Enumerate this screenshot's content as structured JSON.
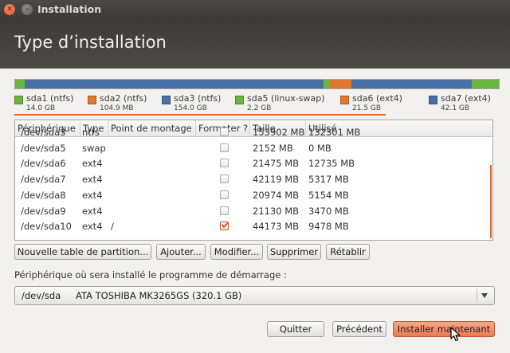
{
  "window": {
    "title": "Installation"
  },
  "header": {
    "title": "Type d’installation"
  },
  "partition_bar": [
    {
      "color": "#6ab43f",
      "pct": 1.9
    },
    {
      "color": "#4a6fa5",
      "pct": 61.9
    },
    {
      "color": "#6ab43f",
      "pct": 1.2
    },
    {
      "color": "#e0772b",
      "pct": 4.6
    },
    {
      "color": "#4a6fa5",
      "pct": 24.8
    },
    {
      "color": "#6ab43f",
      "pct": 5.6
    }
  ],
  "legend": [
    {
      "name": "sda1 (ntfs)",
      "size": "14.0 GB",
      "color": "#6ab43f"
    },
    {
      "name": "sda2 (ntfs)",
      "size": "104.9 MB",
      "color": "#e0772b"
    },
    {
      "name": "sda3 (ntfs)",
      "size": "154.0 GB",
      "color": "#4a6fa5"
    },
    {
      "name": "sda5 (linux-swap)",
      "size": "2.2 GB",
      "color": "#6ab43f"
    },
    {
      "name": "sda6 (ext4)",
      "size": "21.5 GB",
      "color": "#e0772b"
    },
    {
      "name": "sda7 (ext4)",
      "size": "42.1 GB",
      "color": "#4a6fa5"
    }
  ],
  "table": {
    "columns": [
      "Périphérique",
      "Type",
      "Point de montage",
      "Formater ?",
      "Taille",
      "Utilisé"
    ],
    "rows": [
      {
        "device": "/dev/sda3",
        "type": "ntfs",
        "mount": "",
        "format": false,
        "size": "153902 MB",
        "used": "132301 MB"
      },
      {
        "device": "/dev/sda5",
        "type": "swap",
        "mount": "",
        "format": false,
        "size": "2152 MB",
        "used": "0 MB"
      },
      {
        "device": "/dev/sda6",
        "type": "ext4",
        "mount": "",
        "format": false,
        "size": "21475 MB",
        "used": "12735 MB"
      },
      {
        "device": "/dev/sda7",
        "type": "ext4",
        "mount": "",
        "format": false,
        "size": "42119 MB",
        "used": "5317 MB"
      },
      {
        "device": "/dev/sda8",
        "type": "ext4",
        "mount": "",
        "format": false,
        "size": "20974 MB",
        "used": "5154 MB"
      },
      {
        "device": "/dev/sda9",
        "type": "ext4",
        "mount": "",
        "format": false,
        "size": "21130 MB",
        "used": "3470 MB"
      },
      {
        "device": "/dev/sda10",
        "type": "ext4",
        "mount": "/",
        "format": true,
        "size": "44173 MB",
        "used": "9478 MB"
      }
    ]
  },
  "partition_buttons": {
    "new_table": "Nouvelle table de partition...",
    "add": "Ajouter...",
    "modify": "Modifier...",
    "delete": "Supprimer",
    "revert": "Rétablir"
  },
  "bootloader": {
    "label": "Périphérique où sera installé le programme de démarrage :",
    "device": "/dev/sda",
    "model": "ATA TOSHIBA MK3265GS (320.1 GB)"
  },
  "actions": {
    "quit": "Quitter",
    "back": "Précédent",
    "install": "Installer maintenant"
  },
  "colors": {
    "accent": "#e0682b",
    "ntfs": "#6ab43f",
    "ext4": "#4a6fa5"
  }
}
